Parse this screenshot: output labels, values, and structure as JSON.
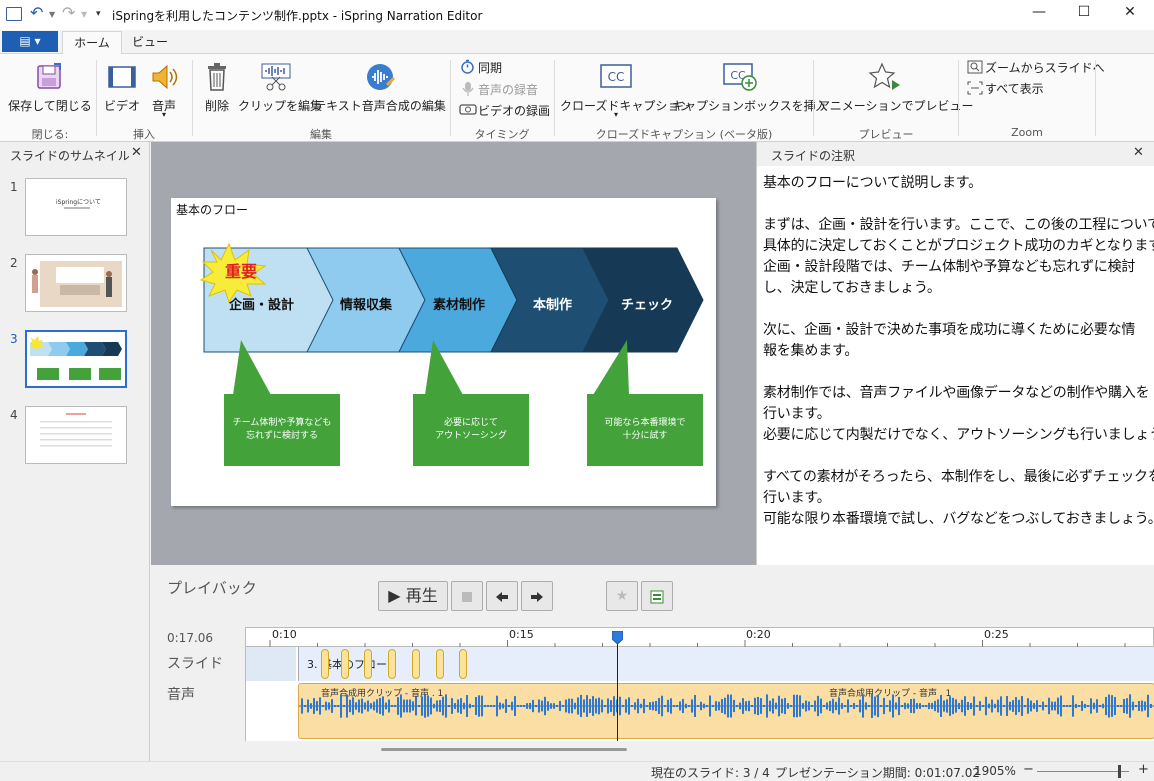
{
  "window": {
    "title": "iSpringを利用したコンテンツ制作.pptx - iSpring Narration Editor",
    "minimize": "—",
    "maximize": "☐",
    "close": "✕"
  },
  "tabs": {
    "file": "▤ ▾",
    "home": "ホーム",
    "view": "ビュー"
  },
  "ribbon": {
    "save_close": "保存して閉じる",
    "video": "ビデオ",
    "audio": "音声",
    "delete": "削除",
    "edit_clip": "クリップを編集",
    "tts_edit": "テキスト音声合成の編集",
    "sync": "同期",
    "record_audio": "音声の録音",
    "record_video": "ビデオの録画",
    "closed_caption": "クローズドキャプション",
    "insert_caption_box": "キャプションボックスを挿入",
    "preview_animation": "アニメーションでプレビュー",
    "zoom_to_slide": "ズームからスライドへ",
    "show_all": "すべて表示",
    "groups": {
      "close": "閉じる:",
      "insert": "挿入",
      "edit": "編集",
      "timing": "タイミング",
      "cc": "クローズドキャプション (ベータ版)",
      "preview": "プレビュー",
      "zoom": "Zoom"
    }
  },
  "thumbnails": {
    "title": "スライドのサムネイル",
    "items": [
      {
        "num": "1",
        "text": "iSpringについて"
      },
      {
        "num": "2",
        "text": ""
      },
      {
        "num": "3",
        "text": ""
      },
      {
        "num": "4",
        "text": ""
      }
    ],
    "selected": 3
  },
  "slide": {
    "title": "基本のフロー",
    "badge": "重要",
    "steps": [
      "企画・設計",
      "情報収集",
      "素材制作",
      "本制作",
      "チェック"
    ],
    "step_colors": [
      "#bfe0f2",
      "#8ecbee",
      "#4ba9dd",
      "#1e4f73",
      "#163a55"
    ],
    "callouts": [
      {
        "line1": "チーム体制や予算なども",
        "line2": "忘れずに検討する"
      },
      {
        "line1": "必要に応じて",
        "line2": "アウトソーシング"
      },
      {
        "line1": "可能なら本番環境で",
        "line2": "十分に試す"
      }
    ]
  },
  "notes": {
    "title": "スライドの注釈",
    "lines": [
      "基本のフローについて説明します。",
      "",
      "まずは、企画・設計を行います。ここで、この後の工程について",
      "具体的に決定しておくことがプロジェクト成功のカギとなります。",
      "企画・設計段階では、チーム体制や予算なども忘れずに検討",
      "し、決定しておきましょう。",
      "",
      "次に、企画・設計で決めた事項を成功に導くために必要な情",
      "報を集めます。",
      "",
      "素材制作では、音声ファイルや画像データなどの制作や購入を",
      "行います。",
      "必要に応じて内製だけでなく、アウトソーシングも行いましょう。",
      "",
      "すべての素材がそろったら、本制作をし、最後に必ずチェックを",
      "行います。",
      "可能な限り本番環境で試し、バグなどをつぶしておきましょう。"
    ]
  },
  "playback": {
    "title": "プレイバック",
    "play": "▶ 再生",
    "current_time": "0:17.06",
    "ticks": [
      "0:10",
      "0:15",
      "0:20",
      "0:25"
    ],
    "slide_track_label": "スライド",
    "audio_track_label": "音声",
    "slide_clip": "3. 基本のフロー",
    "audio_clip_1": "音声合成用クリップ - 音声 . 1",
    "audio_clip_2": "音声合成用クリップ - 音声 . 1"
  },
  "status": {
    "current_slide": "現在のスライド: 3 / 4",
    "duration": "プレゼンテーション期間: 0:01:07.02",
    "zoom": "1905%"
  }
}
